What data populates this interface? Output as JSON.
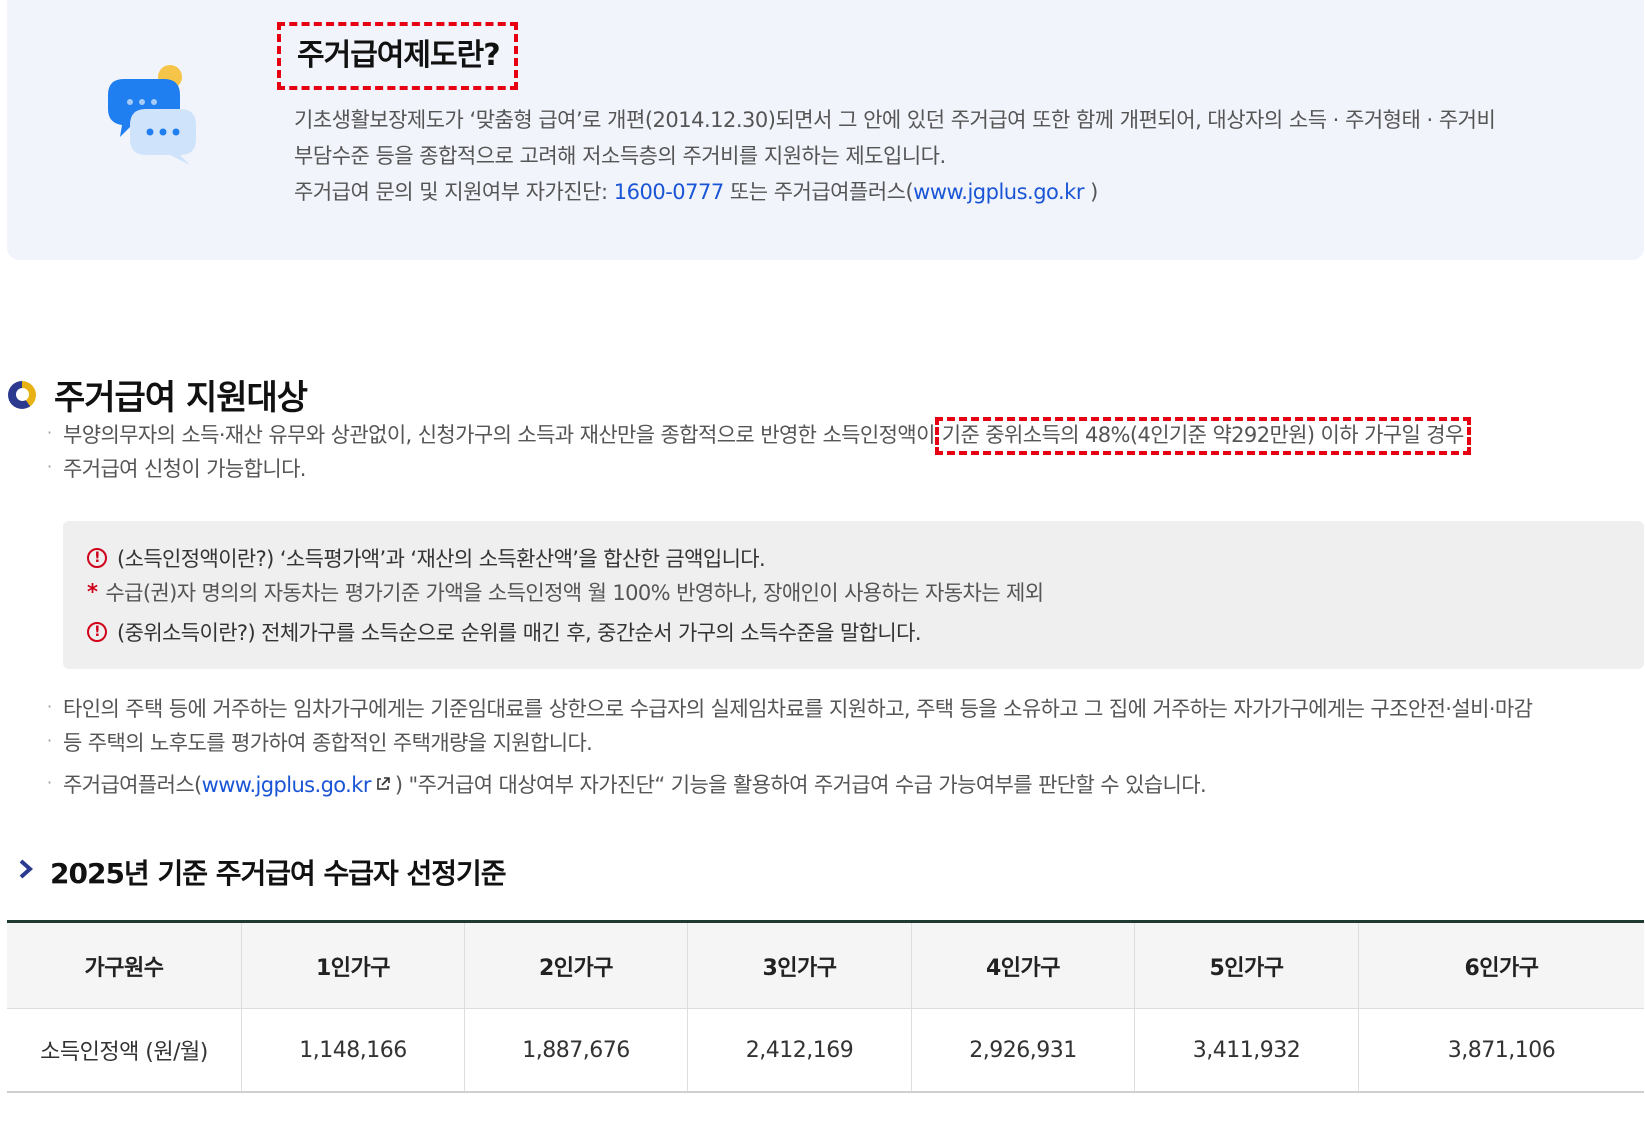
{
  "intro": {
    "title": "주거급여제도란?",
    "line1": "기초생활보장제도가 ‘맞춤형 급여’로 개편(2014.12.30)되면서 그 안에 있던 주거급여 또한 함께 개편되어, 대상자의 소득 · 주거형태 · 주거비",
    "line2": "부담수준 등을 종합적으로 고려해 저소득층의 주거비를 지원하는 제도입니다.",
    "line3_prefix": "주거급여 문의 및 지원여부 자가진단: ",
    "phone": "1600-0777",
    "line3_mid": " 또는 주거급여플러스(",
    "site": "www.jgplus.go.kr",
    "line3_suffix": " )"
  },
  "section": {
    "title": "주거급여 지원대상"
  },
  "bullets": {
    "b1_prefix": "부양의무자의 소득·재산 유무와 상관없이, 신청가구의 소득과 재산만을 종합적으로 반영한 소득인정액이",
    "b1_highlight": "기준 중위소득의 48%(4인기준 약292만원) 이하 가구일 경우",
    "b1_line2": "주거급여 신청이 가능합니다.",
    "b2_line1": "타인의 주택 등에 거주하는 임차가구에게는 기준임대료를 상한으로 수급자의 실제임차료를 지원하고, 주택 등을 소유하고 그 집에 거주하는 자가가구에게는 구조안전·설비·마감",
    "b2_line2": "등 주택의 노후도를 평가하여 종합적인 주택개량을 지원합니다.",
    "b3_prefix": "주거급여플러스(",
    "b3_link": "www.jgplus.go.kr",
    "b3_suffix": ") \"주거급여 대상여부 자가진단“ 기능을 활용하여 주거급여 수급 가능여부를 판단할 수 있습니다."
  },
  "notes": {
    "n1": "(소득인정액이란?) ‘소득평가액’과 ‘재산의 소득환산액’을 합산한 금액입니다.",
    "n2_star": "*",
    "n2": "수급(권)자 명의의 자동차는 평가기준 가액을 소득인정액 월 100% 반영하나, 장애인이 사용하는 자동차는 제외",
    "n3": "(중위소득이란?) 전체가구를 소득순으로 순위를 매긴 후, 중간순서 가구의 소득수준을 말합니다.",
    "warn_glyph": "!"
  },
  "criteria": {
    "title": "2025년 기준 주거급여 수급자 선정기준",
    "headers": [
      "가구원수",
      "1인가구",
      "2인가구",
      "3인가구",
      "4인가구",
      "5인가구",
      "6인가구"
    ],
    "row": [
      "소득인정액 (원/월)",
      "1,148,166",
      "1,887,676",
      "2,412,169",
      "2,926,931",
      "3,411,932",
      "3,871,106"
    ]
  },
  "icons": {
    "chat": "chat-bubbles-icon",
    "ring": "section-ring-icon",
    "chevron": "chevron-right-icon",
    "external": "external-link-icon",
    "warning": "warning-circle-icon"
  },
  "colors": {
    "highlight_border": "#e60012",
    "link": "#1a55d6",
    "intro_bg": "#f1f4fb",
    "table_top_border": "#1f3b30"
  }
}
